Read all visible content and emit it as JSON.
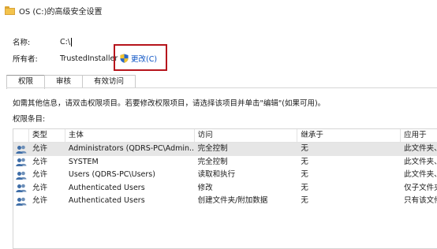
{
  "window": {
    "title": "OS (C:)的高级安全设置"
  },
  "name_field": {
    "label": "名称:",
    "value": "C:\\"
  },
  "owner_field": {
    "label": "所有者:",
    "value": "TrustedInstaller",
    "change_link": "更改(C)"
  },
  "tabs": [
    {
      "label": "权限",
      "active": true
    },
    {
      "label": "审核",
      "active": false
    },
    {
      "label": "有效访问",
      "active": false
    }
  ],
  "info_text": "如需其他信息，请双击权限项目。若要修改权限项目，请选择该项目并单击\"编辑\"(如果可用)。",
  "entries_label": "权限条目:",
  "table": {
    "headers": [
      "类型",
      "主体",
      "访问",
      "继承于",
      "应用于"
    ],
    "rows": [
      {
        "type": "允许",
        "principal": "Administrators (QDRS-PC\\Admin...",
        "access": "完全控制",
        "inherited": "无",
        "applies": "此文件夹、"
      },
      {
        "type": "允许",
        "principal": "SYSTEM",
        "access": "完全控制",
        "inherited": "无",
        "applies": "此文件夹、"
      },
      {
        "type": "允许",
        "principal": "Users (QDRS-PC\\Users)",
        "access": "读取和执行",
        "inherited": "无",
        "applies": "此文件夹、"
      },
      {
        "type": "允许",
        "principal": "Authenticated Users",
        "access": "修改",
        "inherited": "无",
        "applies": "仅子文件夹"
      },
      {
        "type": "允许",
        "principal": "Authenticated Users",
        "access": "创建文件夹/附加数据",
        "inherited": "无",
        "applies": "只有该文件"
      }
    ]
  },
  "icons": {
    "window": "folder-icon",
    "change": "uac-shield-icon",
    "row": "users-icon"
  }
}
